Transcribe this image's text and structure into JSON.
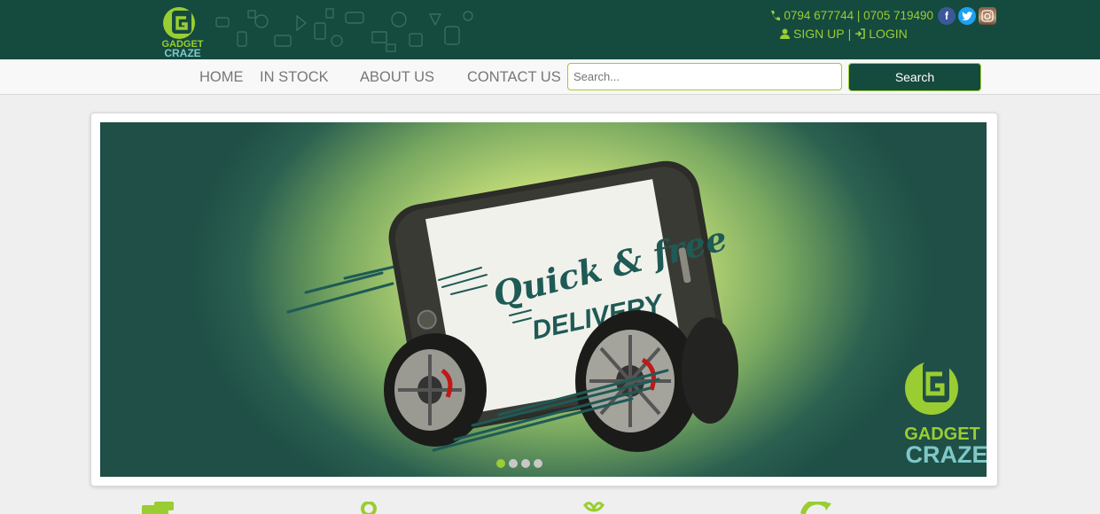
{
  "header": {
    "logo_text_line1": "GADGET",
    "logo_text_line2": "CRAZE",
    "phone": "0794 677744 | 0705 719490",
    "signup_label": "SIGN UP",
    "auth_separator": "|",
    "login_label": "LOGIN",
    "social": {
      "facebook": "f",
      "twitter": "t",
      "instagram": "instagram-icon"
    }
  },
  "nav": {
    "items": [
      {
        "label": "HOME"
      },
      {
        "label": "IN STOCK"
      },
      {
        "label": "ABOUT US"
      },
      {
        "label": "CONTACT US"
      }
    ]
  },
  "search": {
    "placeholder": "Search...",
    "button_label": "Search"
  },
  "slider": {
    "headline_line1": "Quick & free",
    "headline_line2": "DELIVERY",
    "brand_line1": "GADGET",
    "brand_line2": "CRAZE",
    "slide_count": 4,
    "active_slide": 1
  },
  "colors": {
    "brand_dark": "#154a3f",
    "brand_green": "#9acd32"
  }
}
